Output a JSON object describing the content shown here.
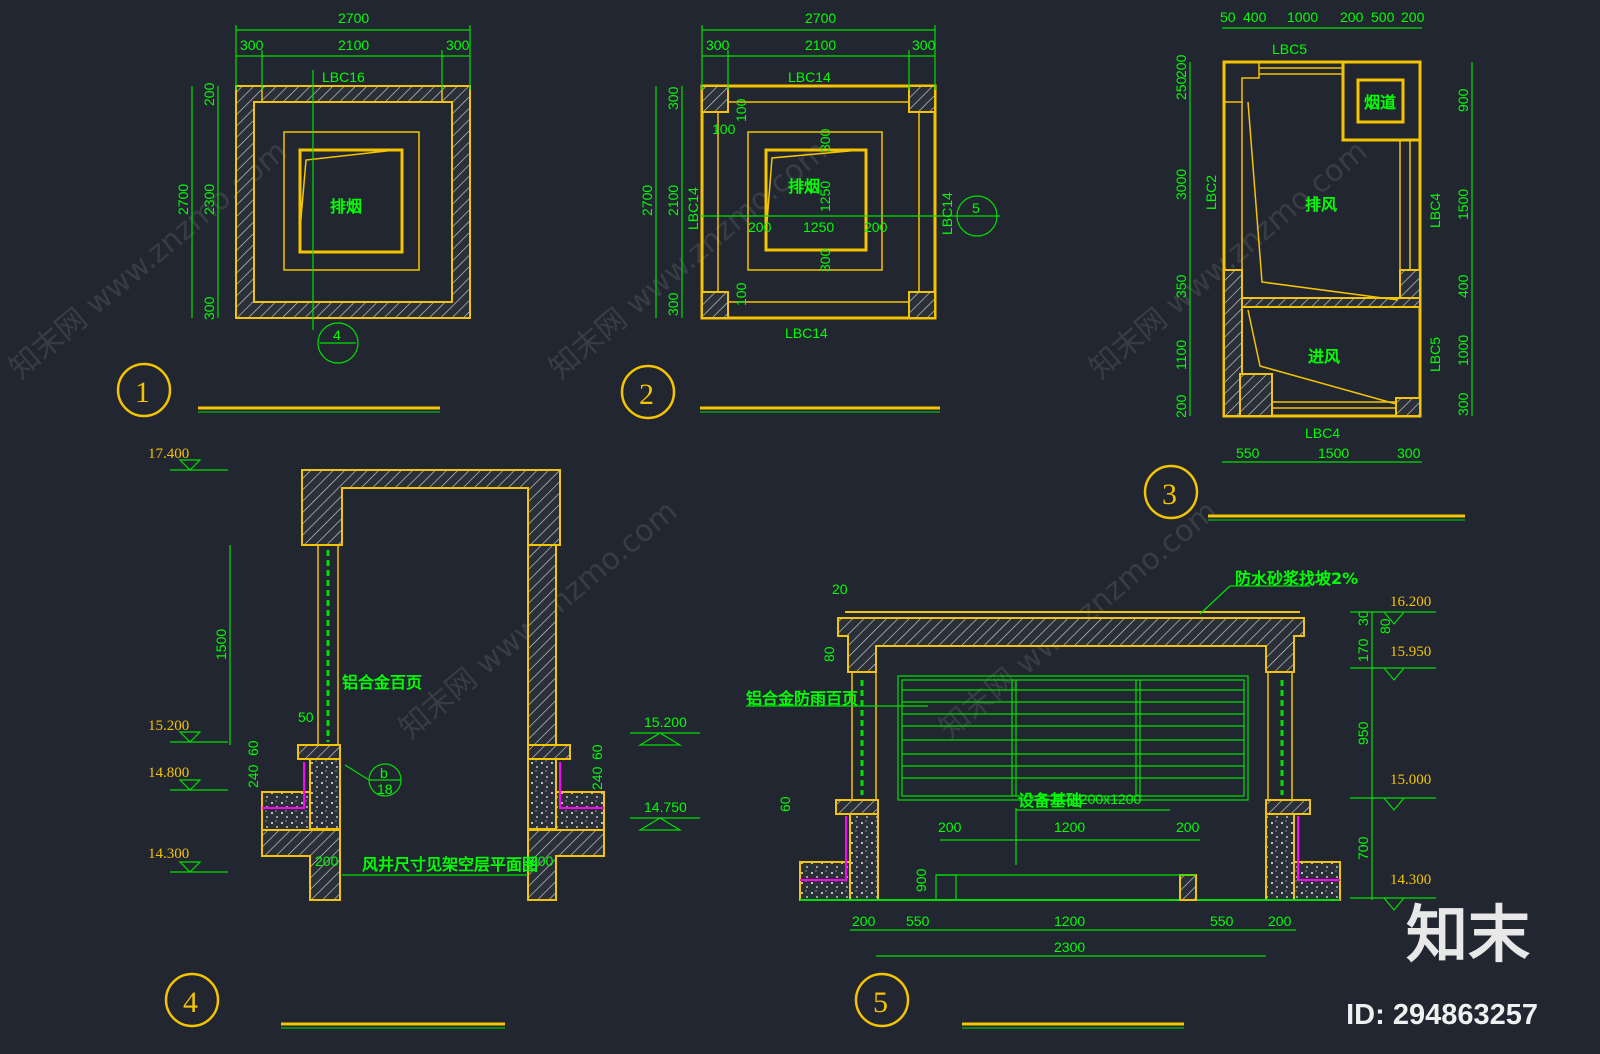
{
  "colors": {
    "background": "#212630",
    "outline": "#f5c400",
    "dimension": "#00ff00",
    "membrane": "#ff00ff"
  },
  "watermark": {
    "text": "知末网 www.znzmo.com",
    "logo": "知末",
    "id": "ID: 294863257"
  },
  "plan1": {
    "number": "1",
    "dim_total": "2700",
    "dim_top": [
      "300",
      "2100",
      "300"
    ],
    "dim_left": [
      "200",
      "2300",
      "300"
    ],
    "dim_left_total": "2700",
    "beam": "LBC16",
    "room": "排烟",
    "section_ref": "4"
  },
  "plan2": {
    "number": "2",
    "dim_total": "2700",
    "dim_top": [
      "300",
      "2100",
      "300"
    ],
    "dim_left": [
      "300",
      "2100",
      "300"
    ],
    "dim_left_total": "2700",
    "beam_top": "LBC14",
    "beam_bottom": "LBC14",
    "beam_left": "LBC14",
    "beam_right": "LBC14",
    "room": "排烟",
    "inner": [
      "200",
      "1250",
      "200"
    ],
    "inner_v": [
      "300",
      "1250",
      "300"
    ],
    "small": [
      "100",
      "100",
      "100"
    ],
    "section_ref": "5"
  },
  "plan3": {
    "number": "3",
    "dim_top": [
      "50",
      "400",
      "1000",
      "200",
      "500",
      "200"
    ],
    "dim_left": [
      "250",
      "200",
      "3000",
      "350",
      "1100",
      "200"
    ],
    "dim_right": [
      "900",
      "1500",
      "400",
      "1000",
      "300"
    ],
    "dim_bottom": [
      "550",
      "1500",
      "300"
    ],
    "beam_top": "LBC5",
    "beam_left": "LBC2",
    "beam_right_top": "LBC4",
    "beam_right_bottom": "LBC5",
    "beam_bottom": "LBC4",
    "flue": "烟道",
    "exhaust": "排风",
    "intake": "进风"
  },
  "section4": {
    "number": "4",
    "levels_left": [
      "17.400",
      "15.200",
      "14.800",
      "14.300"
    ],
    "levels_right": [
      "15.200",
      "14.750"
    ],
    "dim_height": "1500",
    "dim_50": "50",
    "dim_60": "60",
    "dim_240": "240",
    "dim_r60": "60",
    "dim_r240": "240",
    "louver": "铝合金百页",
    "detail_top": "b",
    "detail_bottom": "18",
    "note": "风井尺寸见架空层平面图",
    "wall_l": "200",
    "wall_r": "200"
  },
  "section5": {
    "number": "5",
    "levels": [
      "16.200",
      "15.950",
      "15.000",
      "14.300"
    ],
    "dims_right": [
      "30",
      "80",
      "170",
      "950",
      "700"
    ],
    "dim_20": "20",
    "dim_80": "80",
    "dim_60": "60",
    "roof_note": "防水砂浆找坡2%",
    "louver": "铝合金防雨百页",
    "equipment": "设备基础",
    "equipment_size": "1200x1200",
    "dim_inner": [
      "200",
      "1200",
      "200"
    ],
    "dim_900": "900",
    "dim_bottom": [
      "200",
      "550",
      "1200",
      "550",
      "200"
    ],
    "dim_total": "2300"
  }
}
